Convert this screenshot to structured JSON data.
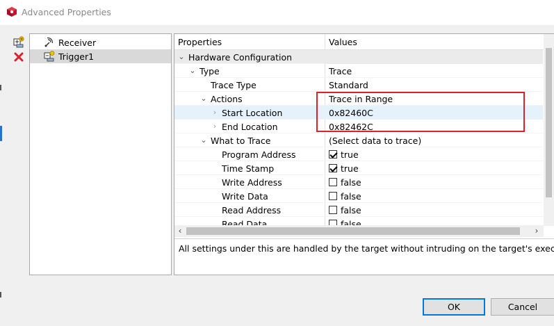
{
  "window": {
    "title": "Advanced Properties"
  },
  "tree": {
    "items": [
      {
        "label": "Receiver",
        "icon": "receiver-icon"
      },
      {
        "label": "Trigger1",
        "icon": "trigger-icon"
      }
    ],
    "selected": "Trigger1"
  },
  "grid": {
    "headers": {
      "properties": "Properties",
      "values": "Values"
    },
    "rows": [
      {
        "label": "Hardware Configuration",
        "value": ""
      },
      {
        "label": "Type",
        "value": "Trace"
      },
      {
        "label": "Trace Type",
        "value": "Standard"
      },
      {
        "label": "Actions",
        "value": "Trace in Range"
      },
      {
        "label": "Start Location",
        "value": "0x82460C"
      },
      {
        "label": "End Location",
        "value": "0x82462C"
      },
      {
        "label": "What to Trace",
        "value": "(Select data to trace)"
      },
      {
        "label": "Program Address",
        "value": "true",
        "checked": true
      },
      {
        "label": "Time Stamp",
        "value": "true",
        "checked": true
      },
      {
        "label": "Write Address",
        "value": "false",
        "checked": false
      },
      {
        "label": "Write Data",
        "value": "false",
        "checked": false
      },
      {
        "label": "Read Address",
        "value": "false",
        "checked": false
      },
      {
        "label": "Read Data",
        "value": "false",
        "checked": false
      }
    ],
    "description": "All settings under this are handled by the target without intruding on the target's execution"
  },
  "buttons": {
    "ok": "OK",
    "cancel": "Cancel"
  },
  "colors": {
    "highlight_box": "#d9222a",
    "selected_row": "#e5f1fb",
    "ok_border": "#0078d7"
  }
}
